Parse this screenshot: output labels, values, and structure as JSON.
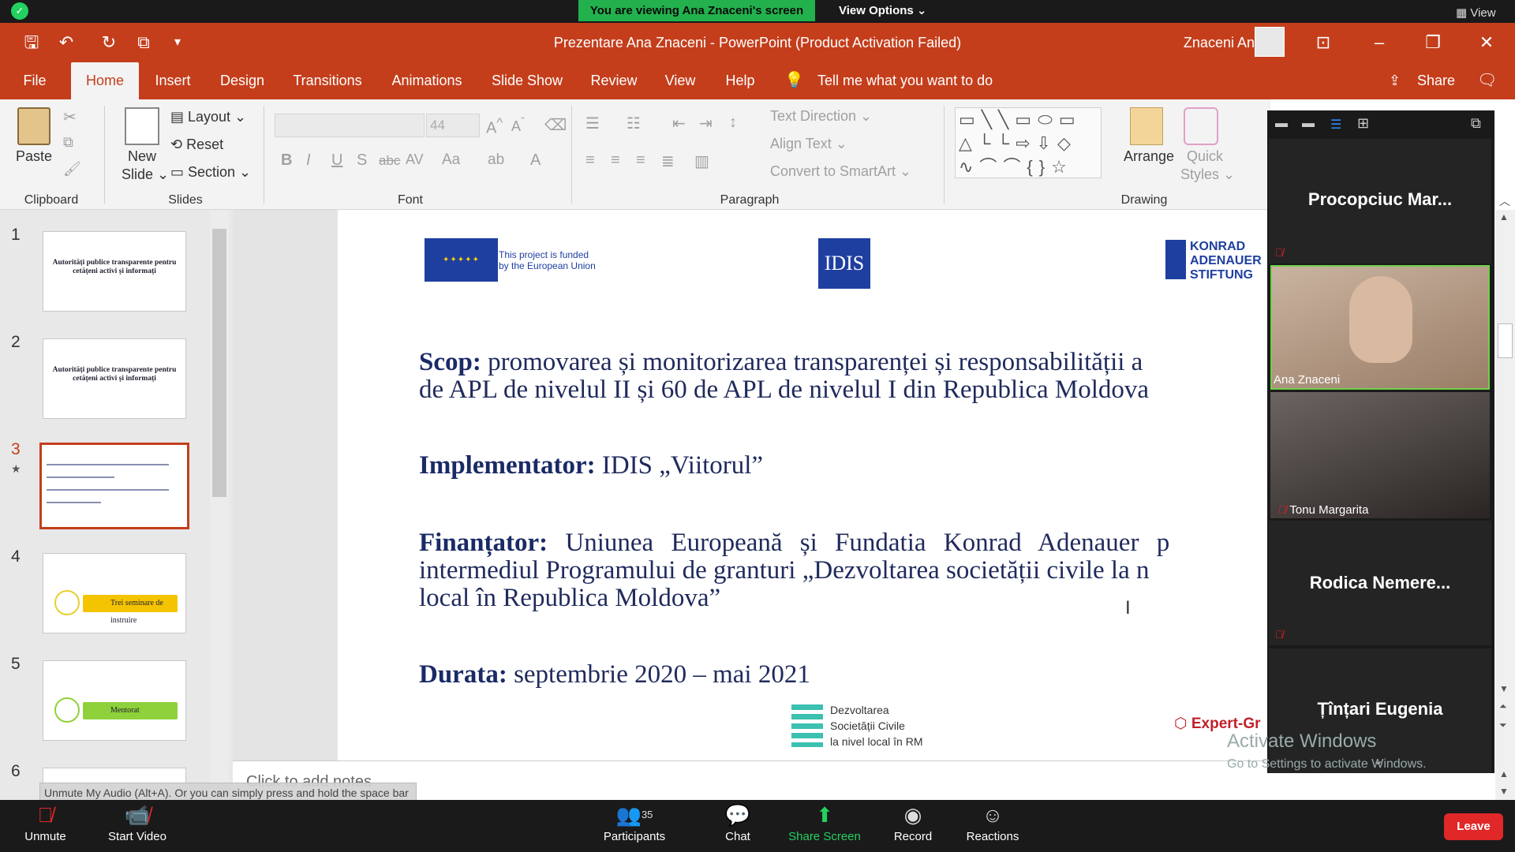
{
  "zoom_top": {
    "viewing_text": "You are viewing Ana Znaceni's screen",
    "view_options": "View Options ⌄",
    "view": "View"
  },
  "titlebar": {
    "title": "Prezentare Ana Znaceni  -  PowerPoint (Product Activation Failed)",
    "user": "Znaceni Ana"
  },
  "tabs": [
    "File",
    "Home",
    "Insert",
    "Design",
    "Transitions",
    "Animations",
    "Slide Show",
    "Review",
    "View",
    "Help"
  ],
  "tell_me": "Tell me what you want to do",
  "share": "Share",
  "ribbon": {
    "clipboard": {
      "paste": "Paste",
      "group": "Clipboard"
    },
    "slides": {
      "new_slide_1": "New",
      "new_slide_2": "Slide ⌄",
      "layout": "Layout ⌄",
      "reset": "Reset",
      "section": "Section ⌄",
      "group": "Slides"
    },
    "font": {
      "size": "44",
      "group": "Font"
    },
    "paragraph": {
      "text_direction": "Text Direction ⌄",
      "align_text": "Align Text ⌄",
      "convert_smartart": "Convert to SmartArt ⌄",
      "group": "Paragraph"
    },
    "drawing": {
      "arrange": "Arrange",
      "quick_styles_1": "Quick",
      "quick_styles_2": "Styles ⌄",
      "group": "Drawing"
    }
  },
  "thumbnails": [
    {
      "num": "1",
      "title": "Autorități publice transparente pentru cetățeni activi și informați"
    },
    {
      "num": "2",
      "title": "Autorități publice transparente pentru cetățeni activi și informați"
    },
    {
      "num": "3",
      "title": ""
    },
    {
      "num": "4",
      "bar": "Trei seminare de instruire",
      "bar_color": "#f5c400"
    },
    {
      "num": "5",
      "bar": "Mentorat",
      "bar_color": "#8fd13a"
    },
    {
      "num": "6",
      "title": ""
    }
  ],
  "slide": {
    "eu_text_1": "This project is funded",
    "eu_text_2": "by the European Union",
    "idis": "IDIS",
    "konrad": "KONRAD ADENAUER STIFTUNG",
    "scop_label": "Scop:",
    "scop_text_1": " promovarea și monitorizarea transparenței și responsabilității a",
    "scop_text_2": "de APL de nivelul II și 60 de APL de nivelul I din Republica Moldova",
    "impl_label": "Implementator:",
    "impl_text": " IDIS „Viitorul”",
    "fin_label": "Finanțator:",
    "fin_text_1": " Uniunea Europeană și Fundatia Konrad Adenauer p",
    "fin_text_2": "intermediul Programului de granturi „Dezvoltarea societății civile la n",
    "fin_text_3": "local în Republica Moldova”",
    "dur_label": "Durata:",
    "dur_text": " septembrie 2020 – mai 2021",
    "footer_logo_1": "Dezvoltarea",
    "footer_logo_2": "Societății Civile",
    "footer_logo_3": "la nivel local în RM",
    "expert": "Expert-Gr"
  },
  "notes_placeholder": "Click to add notes",
  "tooltip": "Unmute My Audio (Alt+A). Or you can simply press and hold the space bar to temporarily unmute.",
  "gallery": {
    "p1": "Procopciuc Mar...",
    "p2": "Ana Znaceni",
    "p3": "Tonu Margarita",
    "p4": "Rodica  Nemere...",
    "p5": "Țînțari Eugenia"
  },
  "activate": {
    "line1": "Activate Windows",
    "line2": "Go to Settings to activate Windows."
  },
  "zoom_bottom": {
    "unmute": "Unmute",
    "start_video": "Start Video",
    "participants": "Participants",
    "participants_count": "35",
    "chat": "Chat",
    "share_screen": "Share Screen",
    "record": "Record",
    "reactions": "Reactions",
    "leave": "Leave"
  }
}
